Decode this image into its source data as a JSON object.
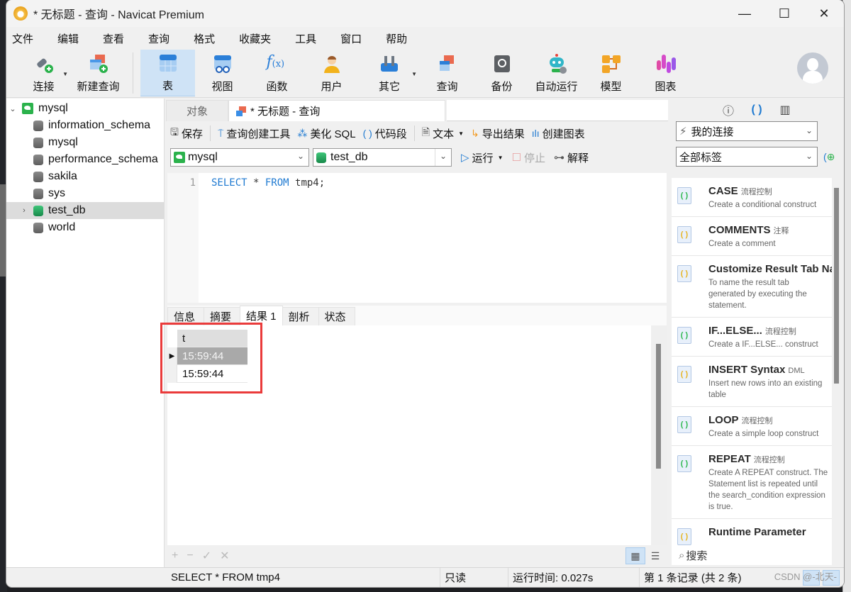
{
  "window": {
    "title": "* 无标题 - 查询 - Navicat Premium",
    "controls": {
      "minimize": "—",
      "maximize": "☐",
      "close": "✕"
    }
  },
  "menu": [
    "文件",
    "编辑",
    "查看",
    "查询",
    "格式",
    "收藏夹",
    "工具",
    "窗口",
    "帮助"
  ],
  "toolbar": {
    "items": [
      {
        "label": "连接",
        "icon": "plug-add-icon",
        "dropdown": true
      },
      {
        "label": "新建查询",
        "icon": "new-query-icon"
      },
      {
        "label": "表",
        "icon": "table-icon",
        "active": true
      },
      {
        "label": "视图",
        "icon": "view-icon"
      },
      {
        "label": "函数",
        "icon": "function-icon"
      },
      {
        "label": "用户",
        "icon": "user-icon"
      },
      {
        "label": "其它",
        "icon": "tools-icon",
        "dropdown": true
      },
      {
        "label": "查询",
        "icon": "query-icon"
      },
      {
        "label": "备份",
        "icon": "backup-icon"
      },
      {
        "label": "自动运行",
        "icon": "robot-icon"
      },
      {
        "label": "模型",
        "icon": "model-icon"
      },
      {
        "label": "图表",
        "icon": "chart-icon"
      }
    ]
  },
  "nav": {
    "connection": "mysql",
    "databases": [
      "information_schema",
      "mysql",
      "performance_schema",
      "sakila",
      "sys",
      "test_db",
      "world"
    ],
    "selected": "test_db"
  },
  "tabs": {
    "objects": "对象",
    "active": "* 无标题 - 查询"
  },
  "query_toolbar": {
    "save": "保存",
    "builder": "查询创建工具",
    "beautify": "美化 SQL",
    "snippet": "代码段",
    "text": "文本",
    "export": "导出结果",
    "chart": "创建图表"
  },
  "selectors": {
    "connection": "mysql",
    "database": "test_db",
    "run": "运行",
    "stop": "停止",
    "explain": "解释"
  },
  "editor": {
    "line": "1",
    "kw1": "SELECT",
    "mid": " * ",
    "kw2": "FROM",
    "rest": " tmp4;"
  },
  "result_tabs": [
    "信息",
    "摘要",
    "结果 1",
    "剖析",
    "状态"
  ],
  "result": {
    "columns": [
      "t"
    ],
    "rows": [
      [
        "15:59:44"
      ],
      [
        "15:59:44"
      ]
    ],
    "selected_row": 0
  },
  "grid_footer": {
    "add": "+",
    "remove": "−",
    "apply": "✓",
    "discard": "✕"
  },
  "right_panel": {
    "connection_filter": "我的连接",
    "tag_filter": "全部标签",
    "snippets": [
      {
        "title": "CASE",
        "tag": "流程控制",
        "desc": "Create a conditional construct",
        "color": "green"
      },
      {
        "title": "COMMENTS",
        "tag": "注释",
        "desc": "Create a comment",
        "color": "yellow"
      },
      {
        "title": "Customize Result Tab Name",
        "tag": "",
        "desc": "To name the result tab generated by executing the statement.",
        "color": "yellow"
      },
      {
        "title": "IF...ELSE...",
        "tag": "流程控制",
        "desc": "Create a IF...ELSE... construct",
        "color": "green"
      },
      {
        "title": "INSERT Syntax",
        "tag": "DML",
        "desc": "Insert new rows into an existing table",
        "color": "yellow"
      },
      {
        "title": "LOOP",
        "tag": "流程控制",
        "desc": "Create a simple loop construct",
        "color": "green"
      },
      {
        "title": "REPEAT",
        "tag": "流程控制",
        "desc": "Create A REPEAT construct. The Statement list is repeated until the search_condition expression is true.",
        "color": "green"
      },
      {
        "title": "Runtime Parameter",
        "tag": "",
        "desc": "",
        "color": "yellow"
      }
    ],
    "search_placeholder": "搜索"
  },
  "statusbar": {
    "sql": "SELECT * FROM tmp4",
    "mode": "只读",
    "runtime": "运行时间: 0.027s",
    "record": "第 1 条记录 (共 2 条)"
  },
  "watermark": "CSDN @-北天-"
}
